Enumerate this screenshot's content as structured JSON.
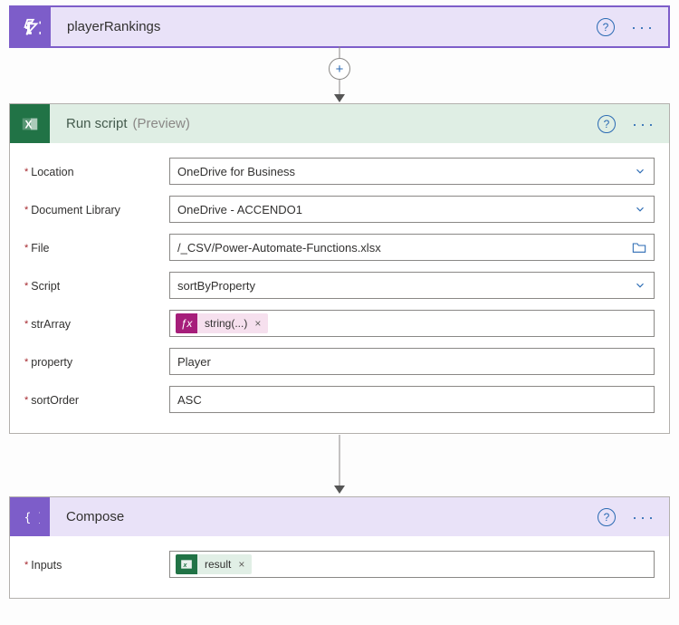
{
  "cards": {
    "playerRankings": {
      "title": "playerRankings"
    },
    "runScript": {
      "title": "Run script",
      "previewTag": "(Preview)",
      "fields": {
        "location": {
          "label": "Location",
          "value": "OneDrive for Business"
        },
        "docLib": {
          "label": "Document Library",
          "value": "OneDrive - ACCENDO1"
        },
        "file": {
          "label": "File",
          "value": "/_CSV/Power-Automate-Functions.xlsx"
        },
        "script": {
          "label": "Script",
          "value": "sortByProperty"
        },
        "strArray": {
          "label": "strArray",
          "token": "string(...)"
        },
        "property": {
          "label": "property",
          "value": "Player"
        },
        "sortOrder": {
          "label": "sortOrder",
          "value": "ASC"
        }
      }
    },
    "compose": {
      "title": "Compose",
      "inputs": {
        "label": "Inputs",
        "token": "result"
      }
    }
  }
}
